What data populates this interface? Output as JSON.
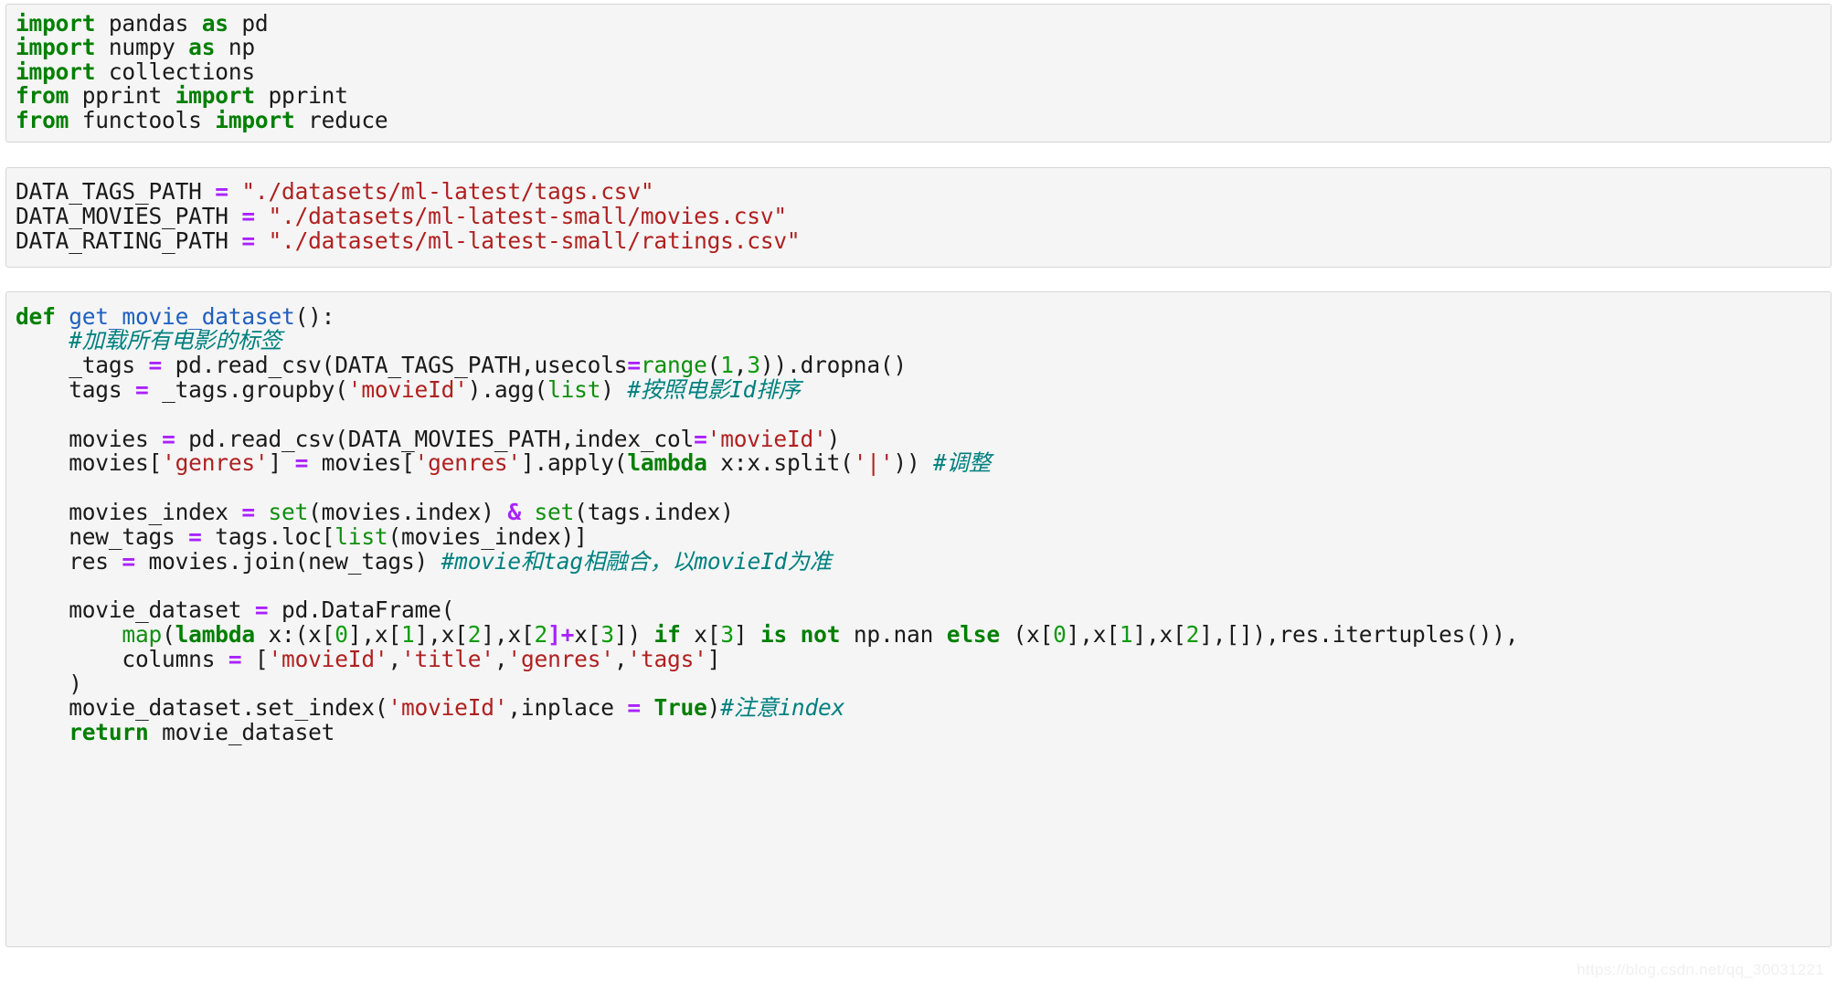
{
  "page": {
    "background_color": "#ffffff",
    "watermark": "https://blog.csdn.net/qq_30031221"
  },
  "theme": {
    "block_background": "#f5f5f5",
    "block_border": "#d6d6d6",
    "text_color": "#1a1a1a",
    "keyword_color": "#007f00",
    "function_name_color": "#1f5fbf",
    "string_color": "#b02020",
    "number_color": "#0f9b0f",
    "builtin_color": "#0f8f0f",
    "operator_color": "#aa22ff",
    "comment_color": "#00807f"
  },
  "blocks": {
    "imports": {
      "name": "import-statements",
      "language": "python",
      "lines": [
        "import pandas as pd",
        "import numpy as np",
        "import collections",
        "from pprint import pprint",
        "from functools import reduce"
      ],
      "tokens": {
        "l1_kw_import": "import",
        "l1_mod": " pandas ",
        "l1_kw_as": "as",
        "l1_alias": " pd",
        "l2_kw_import": "import",
        "l2_mod": " numpy ",
        "l2_kw_as": "as",
        "l2_alias": " np",
        "l3_kw_import": "import",
        "l3_mod": " collections",
        "l4_kw_from": "from",
        "l4_mod": " pprint ",
        "l4_kw_import": "import",
        "l4_name": " pprint",
        "l5_kw_from": "from",
        "l5_mod": " functools ",
        "l5_kw_import": "import",
        "l5_name": " reduce"
      }
    },
    "paths": {
      "name": "path-constants",
      "language": "python",
      "lines": [
        "DATA_TAGS_PATH = \"./datasets/ml-latest/tags.csv\"",
        "DATA_MOVIES_PATH = \"./datasets/ml-latest-small/movies.csv\"",
        "DATA_RATING_PATH = \"./datasets/ml-latest-small/ratings.csv\""
      ],
      "tokens": {
        "tags_var": "DATA_TAGS_PATH ",
        "tags_eq": "=",
        "tags_val": " \"./datasets/ml-latest/tags.csv\"",
        "movies_var": "DATA_MOVIES_PATH ",
        "movies_eq": "=",
        "movies_val": " \"./datasets/ml-latest-small/movies.csv\"",
        "rating_var": "DATA_RATING_PATH ",
        "rating_eq": "=",
        "rating_val": " \"./datasets/ml-latest-small/ratings.csv\""
      }
    },
    "function": {
      "name": "get-movie-dataset-function",
      "language": "python",
      "lines": [
        "def get_movie_dataset():",
        "    #加载所有电影的标签",
        "    _tags = pd.read_csv(DATA_TAGS_PATH,usecols=range(1,3)).dropna()",
        "    tags = _tags.groupby('movieId').agg(list) #按照电影Id排序",
        "",
        "    movies = pd.read_csv(DATA_MOVIES_PATH,index_col='movieId')",
        "    movies['genres'] = movies['genres'].apply(lambda x:x.split('|')) #调整",
        "",
        "    movies_index = set(movies.index) & set(tags.index)",
        "    new_tags = tags.loc[list(movies_index)]",
        "    res = movies.join(new_tags) #movie和tag相融合，以movieId为准",
        "",
        "    movie_dataset = pd.DataFrame(",
        "        map(lambda x:(x[0],x[1],x[2],x[2]+x[3]) if x[3] is not np.nan else (x[0],x[1],x[2],[]),res.itertuples()),",
        "        columns = ['movieId','title','genres','tags']",
        "    )",
        "    movie_dataset.set_index('movieId',inplace = True)#注意index",
        "    return movie_dataset"
      ],
      "tokens": {
        "def_kw": "def",
        "def_name": " get_movie_dataset",
        "def_tail": "():",
        "c1_indent": "    ",
        "c1_comment": "#加载所有电影的标签",
        "t1_indent": "    ",
        "t1_lhs": "_tags ",
        "t1_eq": "=",
        "t1_mid": " pd.read_csv(DATA_TAGS_PATH,usecols",
        "t1_eq2": "=",
        "t1_range": "range",
        "t1_p1": "(",
        "t1_n1": "1",
        "t1_comma": ",",
        "t1_n2": "3",
        "t1_tail": ")).dropna()",
        "t2_indent": "    ",
        "t2_lhs": "tags ",
        "t2_eq": "=",
        "t2_mid": " _tags.groupby(",
        "t2_str": "'movieId'",
        "t2_mid2": ").agg(",
        "t2_list": "list",
        "t2_tail": ") ",
        "t2_comment": "#按照电影Id排序",
        "m1_indent": "    ",
        "m1_lhs": "movies ",
        "m1_eq": "=",
        "m1_mid": " pd.read_csv(DATA_MOVIES_PATH,index_col",
        "m1_eq2": "=",
        "m1_str": "'movieId'",
        "m1_tail": ")",
        "m2_indent": "    ",
        "m2_a": "movies[",
        "m2_s1": "'genres'",
        "m2_b": "] ",
        "m2_eq": "=",
        "m2_c": " movies[",
        "m2_s2": "'genres'",
        "m2_d": "].apply(",
        "m2_lambda": "lambda",
        "m2_e": " x:x.split(",
        "m2_s3": "'|'",
        "m2_f": ")) ",
        "m2_comment": "#调整",
        "i1_indent": "    ",
        "i1_lhs": "movies_index ",
        "i1_eq": "=",
        "i1_set1": " set",
        "i1_mid": "(movies.index) ",
        "i1_amp": "&",
        "i1_set2": " set",
        "i1_tail": "(tags.index)",
        "i2_indent": "    ",
        "i2_lhs": "new_tags ",
        "i2_eq": "=",
        "i2_mid": " tags.loc[",
        "i2_list": "list",
        "i2_tail": "(movies_index)]",
        "i3_indent": "    ",
        "i3_lhs": "res ",
        "i3_eq": "=",
        "i3_mid": " movies.join(new_tags) ",
        "i3_comment": "#movie和tag相融合，以movieId为准",
        "d1_indent": "    ",
        "d1_lhs": "movie_dataset ",
        "d1_eq": "=",
        "d1_tail": " pd.DataFrame(",
        "d2_indent": "        ",
        "d2_map": "map",
        "d2_a": "(",
        "d2_lambda": "lambda",
        "d2_b": " x:(x[",
        "d2_n0": "0",
        "d2_c": "],x[",
        "d2_n1": "1",
        "d2_d": "],x[",
        "d2_n2": "2",
        "d2_e": "],x[",
        "d2_n3": "2",
        "d2_plus": "]+",
        "d2_f": "x[",
        "d2_n4": "3",
        "d2_g": "]) ",
        "d2_if": "if",
        "d2_h": " x[",
        "d2_n5": "3",
        "d2_i": "] ",
        "d2_isnot": "is not",
        "d2_j": " np.nan ",
        "d2_else": "else",
        "d2_k": " (x[",
        "d2_n6": "0",
        "d2_l": "],x[",
        "d2_n7": "1",
        "d2_m": "],x[",
        "d2_n8": "2",
        "d2_tail": "],[]),res.itertuples()),",
        "d3_indent": "        ",
        "d3_lhs": "columns ",
        "d3_eq": "=",
        "d3_open": " [",
        "d3_s1": "'movieId'",
        "d3_c1": ",",
        "d3_s2": "'title'",
        "d3_c2": ",",
        "d3_s3": "'genres'",
        "d3_c3": ",",
        "d3_s4": "'tags'",
        "d3_close": "]",
        "d4_indent": "    ",
        "d4_close": ")",
        "si_indent": "    ",
        "si_a": "movie_dataset.set_index(",
        "si_str": "'movieId'",
        "si_b": ",inplace ",
        "si_eq": "=",
        "si_c": " ",
        "si_true": "True",
        "si_d": ")",
        "si_comment": "#注意index",
        "ret_indent": "    ",
        "ret_kw": "return",
        "ret_val": " movie_dataset"
      }
    }
  }
}
